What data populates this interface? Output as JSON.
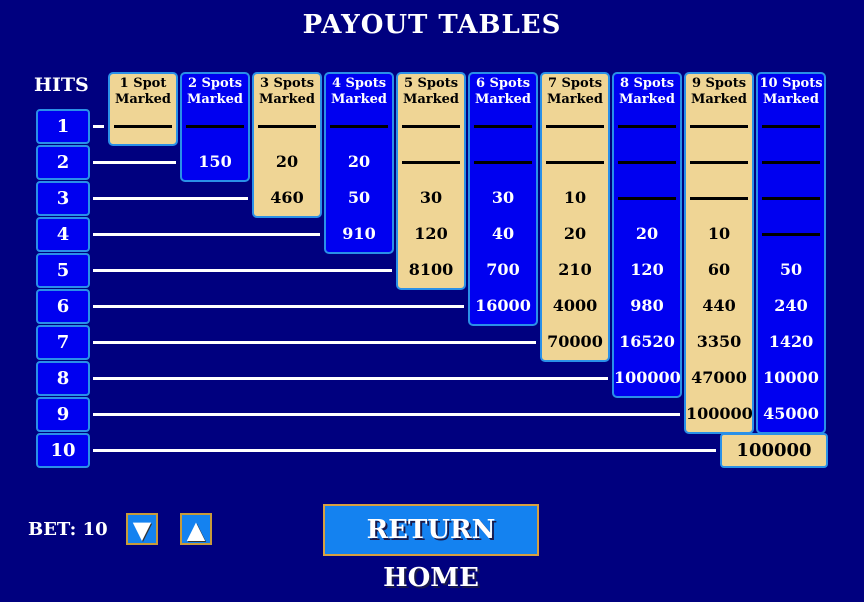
{
  "title": "PAYOUT TABLES",
  "hits_label": "HITS",
  "hits": [
    "1",
    "2",
    "3",
    "4",
    "5",
    "6",
    "7",
    "8",
    "9",
    "10"
  ],
  "columns": [
    {
      "label_top": "1 Spot",
      "label_bottom": "Marked",
      "style": "tan",
      "payouts": [
        "—"
      ]
    },
    {
      "label_top": "2 Spots",
      "label_bottom": "Marked",
      "style": "blue",
      "payouts": [
        "—",
        "150"
      ]
    },
    {
      "label_top": "3 Spots",
      "label_bottom": "Marked",
      "style": "tan",
      "payouts": [
        "—",
        "20",
        "460"
      ]
    },
    {
      "label_top": "4 Spots",
      "label_bottom": "Marked",
      "style": "blue",
      "payouts": [
        "—",
        "20",
        "50",
        "910"
      ]
    },
    {
      "label_top": "5 Spots",
      "label_bottom": "Marked",
      "style": "tan",
      "payouts": [
        "—",
        "—",
        "30",
        "120",
        "8100"
      ]
    },
    {
      "label_top": "6 Spots",
      "label_bottom": "Marked",
      "style": "blue",
      "payouts": [
        "—",
        "—",
        "30",
        "40",
        "700",
        "16000"
      ]
    },
    {
      "label_top": "7 Spots",
      "label_bottom": "Marked",
      "style": "tan",
      "payouts": [
        "—",
        "—",
        "10",
        "20",
        "210",
        "4000",
        "70000"
      ]
    },
    {
      "label_top": "8 Spots",
      "label_bottom": "Marked",
      "style": "blue",
      "payouts": [
        "—",
        "—",
        "—",
        "20",
        "120",
        "980",
        "16520",
        "100000"
      ]
    },
    {
      "label_top": "9 Spots",
      "label_bottom": "Marked",
      "style": "tan",
      "payouts": [
        "—",
        "—",
        "—",
        "10",
        "60",
        "440",
        "3350",
        "47000",
        "100000"
      ]
    },
    {
      "label_top": "10 Spots",
      "label_bottom": "Marked",
      "style": "blue",
      "payouts": [
        "—",
        "—",
        "—",
        "—",
        "50",
        "240",
        "1420",
        "10000",
        "45000",
        "100000"
      ]
    }
  ],
  "bet": {
    "label": "BET:",
    "value": "10",
    "down_icon": "▼",
    "up_icon": "▲"
  },
  "return_home_label": "RETURN HOME",
  "colors": {
    "background": "#00007f",
    "tan": "#efd595",
    "blue": "#0000f0",
    "border": "#2a90e8",
    "button": "#1482f0",
    "button_border": "#d8a040"
  }
}
